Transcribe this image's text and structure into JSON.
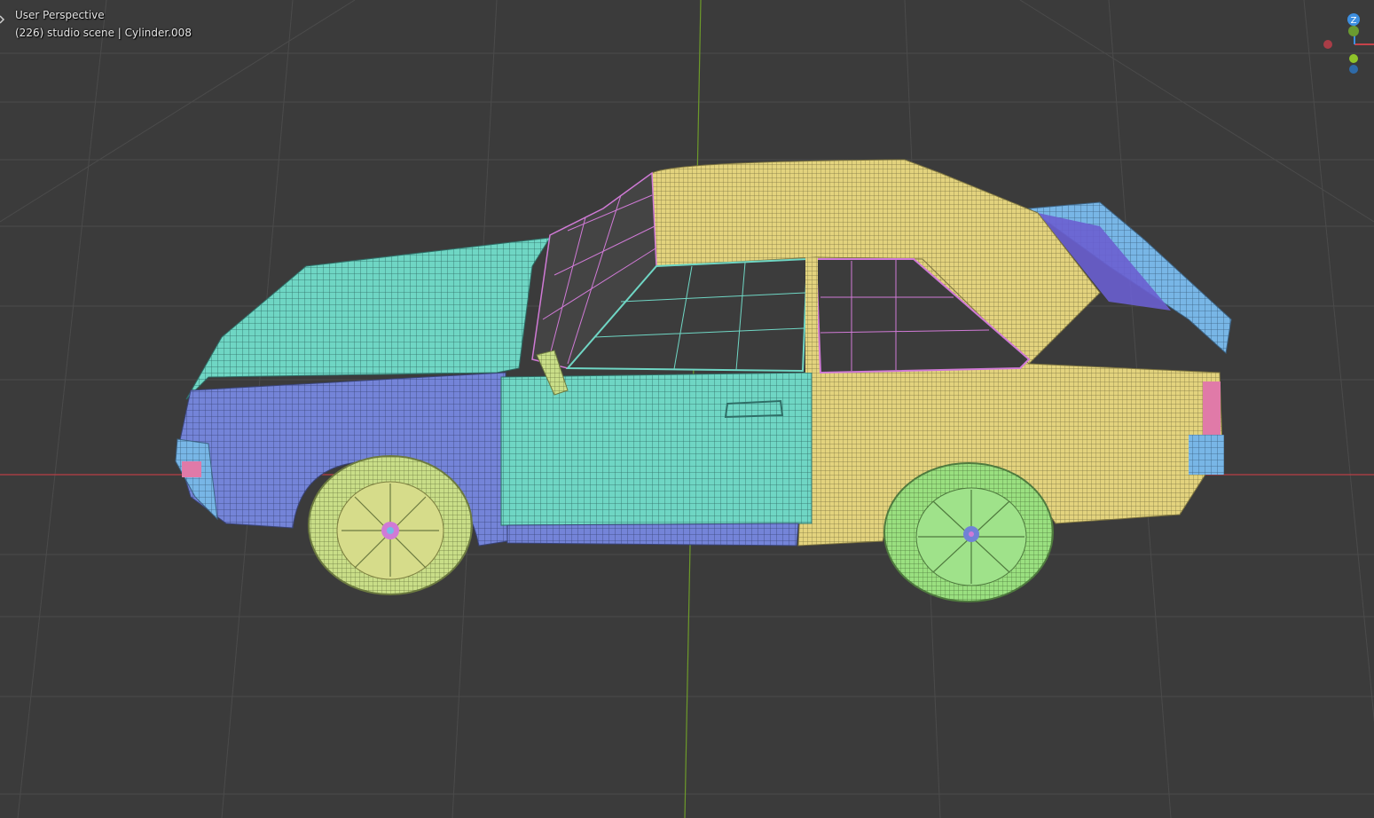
{
  "viewport": {
    "view_label": "User Perspective",
    "scene_label": "(226) studio scene | Cylinder.008"
  },
  "gizmo": {
    "z_label": "Z",
    "colors": {
      "x": "#c6424a",
      "y": "#7fbf2a",
      "z": "#3d8fe0"
    }
  },
  "colors": {
    "background": "#3b3b3b",
    "grid": "#4a4a4a",
    "x_axis": "#b83f45",
    "y_axis": "#6d9a2a",
    "mesh_cyan": "#6fd6c4",
    "mesh_blue": "#7082d6",
    "mesh_yellow": "#e3d37e",
    "mesh_green": "#8fe07a",
    "mesh_magenta": "#d07ad6",
    "mesh_sky": "#76b8e8",
    "mesh_pink": "#e07aa8"
  }
}
